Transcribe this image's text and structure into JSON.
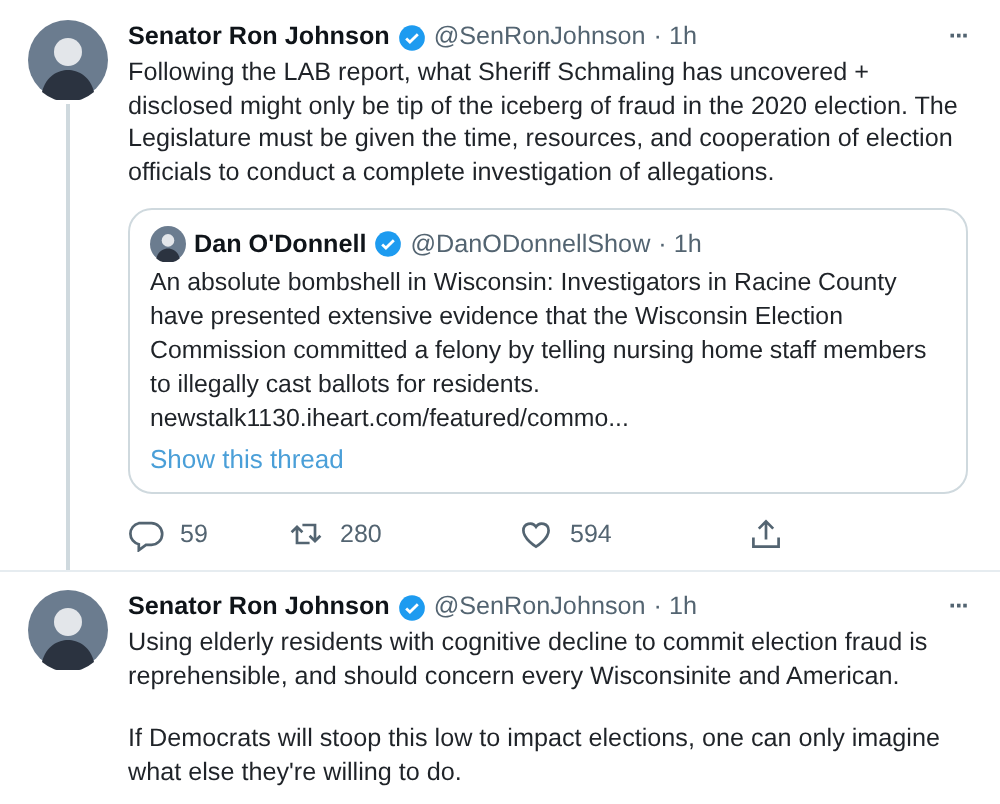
{
  "tweets": [
    {
      "author": "Senator Ron Johnson",
      "verified": true,
      "handle": "@SenRonJohnson",
      "time": "· 1h",
      "more": "···",
      "thread_line": true,
      "paragraphs": [
        "Following the LAB report, what Sheriff Schmaling has uncovered + disclosed might only be tip of the iceberg of fraud in the 2020 election. The Legislature must be given the time, resources, and cooperation of election officials to conduct a complete investigation of allegations."
      ],
      "quote": {
        "author": "Dan O'Donnell",
        "verified": true,
        "handle": "@DanODonnellShow",
        "time": "· 1h",
        "text": "An absolute bombshell in Wisconsin: Investigators in Racine County have presented extensive evidence that the Wisconsin Election Commission committed a felony by telling nursing home staff members to illegally cast ballots for residents.",
        "link": "newstalk1130.iheart.com/featured/commo...",
        "thread_link": "Show this thread"
      },
      "actions": [
        {
          "kind": "reply",
          "count": "59"
        },
        {
          "kind": "retweet",
          "count": "280"
        },
        {
          "kind": "like",
          "count": "594"
        },
        {
          "kind": "share"
        }
      ]
    },
    {
      "author": "Senator Ron Johnson",
      "verified": true,
      "handle": "@SenRonJohnson",
      "time": "· 1h",
      "more": "···",
      "thread_line": false,
      "paragraphs": [
        "Using elderly residents with cognitive decline to commit election fraud is reprehensible, and should concern every Wisconsinite and American.",
        "If Democrats will stoop this low to impact elections, one can only imagine what else they're willing to do."
      ]
    }
  ]
}
